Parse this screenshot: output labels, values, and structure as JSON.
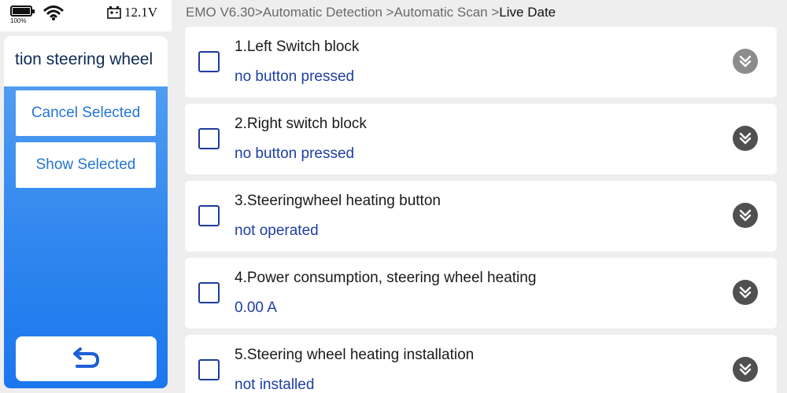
{
  "status": {
    "battery_percent": "100%",
    "battery_level": 1.0,
    "voltage": "12.1V"
  },
  "sidebar": {
    "title": "tion steering wheel",
    "cancel_label": "Cancel Selected",
    "show_label": "Show Selected"
  },
  "breadcrumb": {
    "path": "EMO V6.30>Automatic Detection >Automatic Scan >",
    "current": "Live Date"
  },
  "items": [
    {
      "name": "1.Left Switch block",
      "value": "no button pressed"
    },
    {
      "name": "2.Right switch block",
      "value": "no button pressed"
    },
    {
      "name": "3.Steeringwheel heating button",
      "value": "not operated"
    },
    {
      "name": "4.Power consumption, steering wheel heating",
      "value": "0.00 A"
    },
    {
      "name": "5.Steering wheel heating installation",
      "value": "not installed"
    }
  ],
  "colors": {
    "sidebar_top": "#5aa3f2",
    "sidebar_bottom": "#1c76ee",
    "button_text": "#2476d2",
    "value_text": "#1e3fa3"
  }
}
